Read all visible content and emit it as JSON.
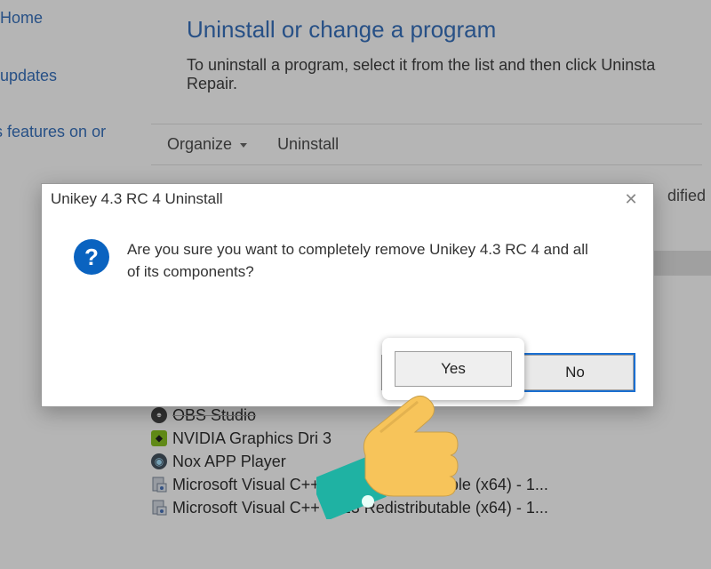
{
  "sidebar": {
    "items": [
      {
        "label": "Home"
      },
      {
        "label": "updates"
      },
      {
        "label": "s features on or"
      }
    ]
  },
  "page": {
    "title": "Uninstall or change a program",
    "description": "To uninstall a program, select it from the list and then click Uninsta Repair."
  },
  "toolbar": {
    "organize_label": "Organize",
    "uninstall_label": "Uninstall"
  },
  "columns": {
    "modified_fragment": "dified"
  },
  "programs": [
    {
      "name": "OBS Studio",
      "icon": "obs"
    },
    {
      "name": "NVIDIA Graphics Dri           3",
      "icon": "nvidia"
    },
    {
      "name": "Nox APP Player",
      "icon": "nox"
    },
    {
      "name": "Microsoft Visual C++ 2015 Redistributable (x64) - 1...",
      "icon": "vc"
    },
    {
      "name": "Microsoft Visual C++ 2013 Redistributable (x64) - 1...",
      "icon": "vc"
    }
  ],
  "dialog": {
    "title": "Unikey 4.3 RC 4 Uninstall",
    "message": "Are you sure you want to completely remove Unikey 4.3 RC 4 and all of its components?",
    "yes_label": "Yes",
    "no_label": "No"
  },
  "colors": {
    "link_blue": "#1a5db3",
    "accent_blue": "#0a63c0",
    "focus_blue": "#1a6fd1",
    "hand_yellow": "#f7c45a",
    "sleeve_teal": "#1fb2a3"
  }
}
